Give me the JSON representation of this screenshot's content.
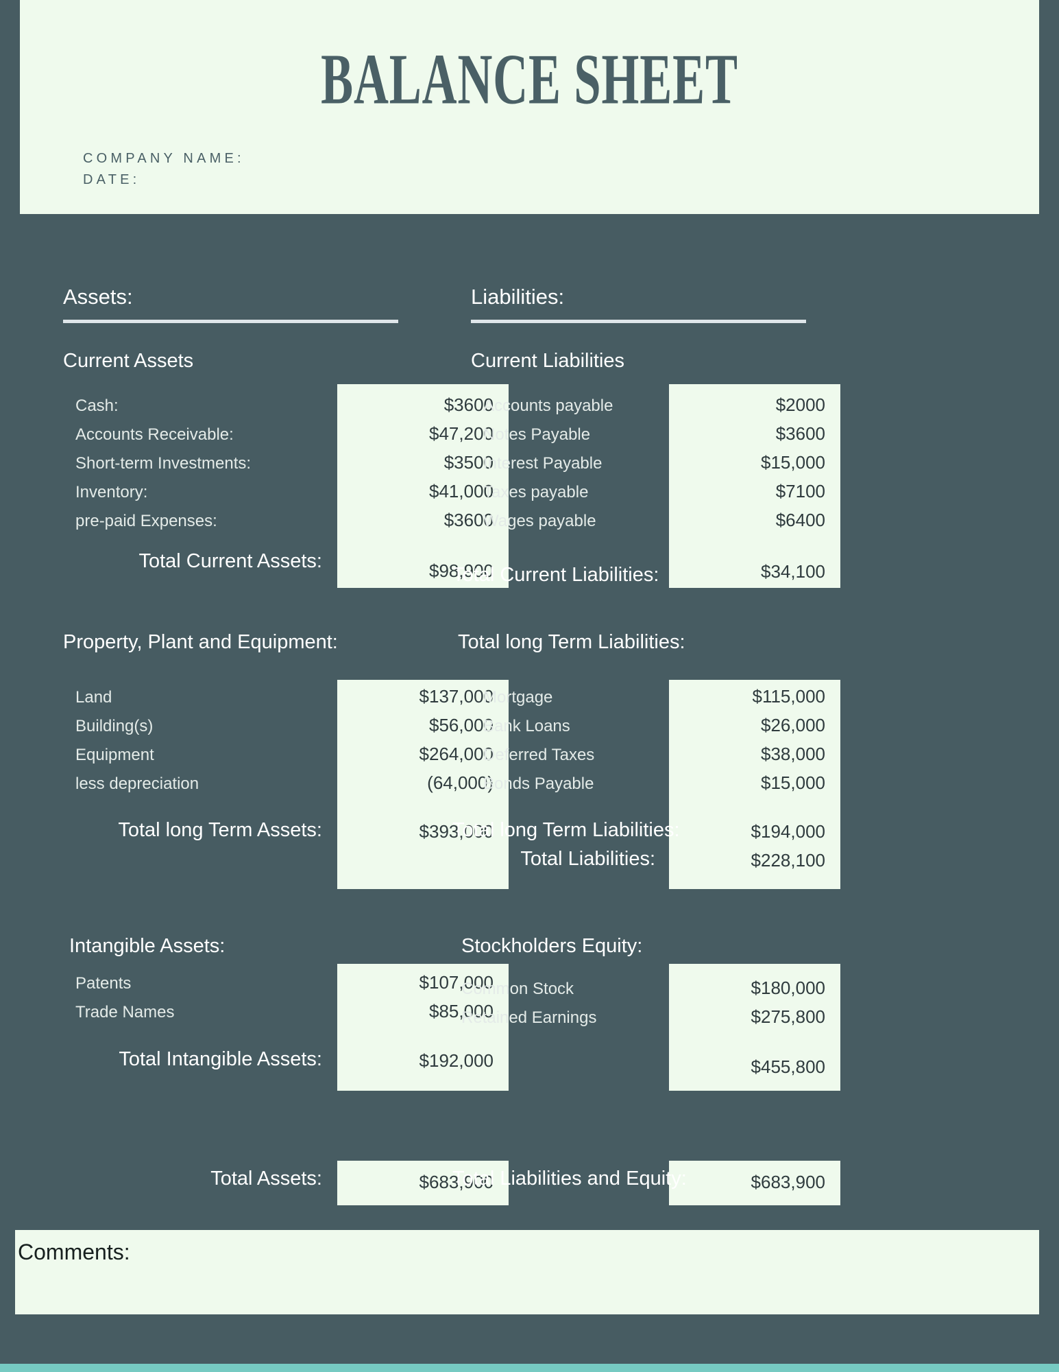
{
  "header": {
    "title": "BALANCE SHEET",
    "company_label": "COMPANY NAME:",
    "date_label": "DATE:"
  },
  "assets": {
    "section_title": "Assets:",
    "current": {
      "group_title": "Current Assets",
      "rows": [
        {
          "label": "Cash:",
          "value": "$3600"
        },
        {
          "label": "Accounts Receivable:",
          "value": "$47,200"
        },
        {
          "label": "Short-term Investments:",
          "value": "$3500"
        },
        {
          "label": "Inventory:",
          "value": "$41,000"
        },
        {
          "label": "pre-paid Expenses:",
          "value": "$3600"
        }
      ],
      "total_label": "Total Current Assets:",
      "total_value": "$98,900"
    },
    "ppe": {
      "group_title": "Property, Plant and Equipment:",
      "rows": [
        {
          "label": "Land",
          "value": "$137,000"
        },
        {
          "label": "Building(s)",
          "value": "$56,000"
        },
        {
          "label": "Equipment",
          "value": "$264,000"
        },
        {
          "label": "less depreciation",
          "value": "(64,000)"
        }
      ],
      "total_label": "Total long Term Assets:",
      "total_value": "$393,000"
    },
    "intangible": {
      "group_title": "Intangible Assets:",
      "rows": [
        {
          "label": "Patents",
          "value": "$107,000"
        },
        {
          "label": "Trade Names",
          "value": "$85,000"
        }
      ],
      "total_label": "Total Intangible Assets:",
      "total_value": "$192,000"
    },
    "grand_label": "Total Assets:",
    "grand_value": "$683,900"
  },
  "liabilities": {
    "section_title": "Liabilities:",
    "current": {
      "group_title": "Current Liabilities",
      "rows": [
        {
          "label": "Accounts payable",
          "value": "$2000"
        },
        {
          "label": "Notes Payable",
          "value": "$3600"
        },
        {
          "label": "Interest Payable",
          "value": "$15,000"
        },
        {
          "label": "Taxes payable",
          "value": "$7100"
        },
        {
          "label": "Wages payable",
          "value": "$6400"
        }
      ],
      "total_label": "Total Current Liabilities:",
      "total_value": "$34,100"
    },
    "longterm": {
      "group_title": "Total long Term Liabilities:",
      "rows": [
        {
          "label": "Mortgage",
          "value": "$115,000"
        },
        {
          "label": "Bank Loans",
          "value": "$26,000"
        },
        {
          "label": "Deferred Taxes",
          "value": "$38,000"
        },
        {
          "label": "Bonds Payable",
          "value": "$15,000"
        }
      ],
      "total_label": "Total long Term Liabilities:",
      "total_value": "$194,000",
      "total_all_label": "Total Liabilities:",
      "total_all_value": "$228,100"
    },
    "equity": {
      "group_title": "Stockholders Equity:",
      "rows": [
        {
          "label": "Common Stock",
          "value": "$180,000"
        },
        {
          "label": "Retained Earnings",
          "value": "$275,800"
        }
      ],
      "total_value": "$455,800"
    },
    "grand_label": "Total Liabilities and Equity:",
    "grand_value": "$683,900"
  },
  "comments": {
    "label": "Comments:"
  },
  "colors": {
    "background": "#475c62",
    "panel": "#effaed",
    "accent": "#76cac2",
    "rule": "#dfe6ea"
  }
}
